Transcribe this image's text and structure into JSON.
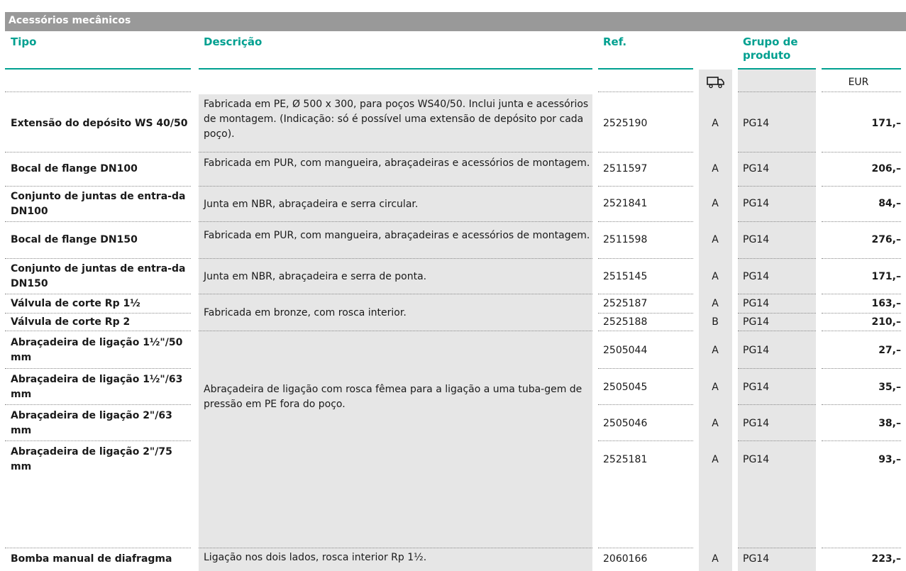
{
  "title": "Acessórios mecânicos",
  "headers": {
    "tipo": "Tipo",
    "descricao": "Descrição",
    "ref": "Ref.",
    "grupo_line1": "Grupo de",
    "grupo_line2": "produto",
    "currency": "EUR",
    "availability_icon": "truck-icon"
  },
  "colors": {
    "accent": "#00a090",
    "title_bar": "#999999",
    "shade": "#e6e6e6"
  },
  "rows": [
    {
      "tipo": "Extensão do depósito WS 40/50",
      "ref": "2525190",
      "cls": "A",
      "grupo": "PG14",
      "price": "171,–"
    },
    {
      "tipo": "Bocal de flange DN100",
      "ref": "2511597",
      "cls": "A",
      "grupo": "PG14",
      "price": "206,–"
    },
    {
      "tipo": "Conjunto de juntas de entra-da DN100",
      "ref": "2521841",
      "cls": "A",
      "grupo": "PG14",
      "price": "84,–"
    },
    {
      "tipo": "Bocal de flange DN150",
      "ref": "2511598",
      "cls": "A",
      "grupo": "PG14",
      "price": "276,–"
    },
    {
      "tipo": "Conjunto de juntas de entra-da DN150",
      "ref": "2515145",
      "cls": "A",
      "grupo": "PG14",
      "price": "171,–"
    },
    {
      "tipo": "Válvula de corte Rp 1½",
      "ref": "2525187",
      "cls": "A",
      "grupo": "PG14",
      "price": "163,–"
    },
    {
      "tipo": "Válvula de corte Rp 2",
      "ref": "2525188",
      "cls": "B",
      "grupo": "PG14",
      "price": "210,–"
    },
    {
      "tipo": "Abraçadeira de ligação 1½\"/50 mm",
      "ref": "2505044",
      "cls": "A",
      "grupo": "PG14",
      "price": "27,–"
    },
    {
      "tipo": "Abraçadeira de ligação 1½\"/63 mm",
      "ref": "2505045",
      "cls": "A",
      "grupo": "PG14",
      "price": "35,–"
    },
    {
      "tipo": "Abraçadeira de ligação 2\"/63 mm",
      "ref": "2505046",
      "cls": "A",
      "grupo": "PG14",
      "price": "38,–"
    },
    {
      "tipo": "Abraçadeira de ligação 2\"/75 mm",
      "ref": "2525181",
      "cls": "A",
      "grupo": "PG14",
      "price": "93,–"
    },
    {
      "tipo": "Bomba manual de diafragma",
      "ref": "2060166",
      "cls": "A",
      "grupo": "PG14",
      "price": "223,–"
    }
  ],
  "descriptions": [
    "Fabricada em PE, Ø 500 x 300, para poços WS40/50. Inclui junta e acessórios de montagem. (Indicação: só é possível uma extensão de depósito por cada poço).",
    "Fabricada em PUR, com mangueira, abraçadeiras e acessórios de montagem.",
    "Junta em NBR, abraçadeira e serra circular.",
    "Fabricada em PUR, com mangueira, abraçadeiras e acessórios de montagem.",
    "Junta em NBR, abraçadeira e serra de ponta.",
    "Fabricada em bronze, com rosca interior.",
    "Abraçadeira de ligação com rosca fêmea para a ligação a uma tuba-gem de pressão em PE fora do poço.",
    "Ligação nos dois lados, rosca interior Rp 1½."
  ]
}
